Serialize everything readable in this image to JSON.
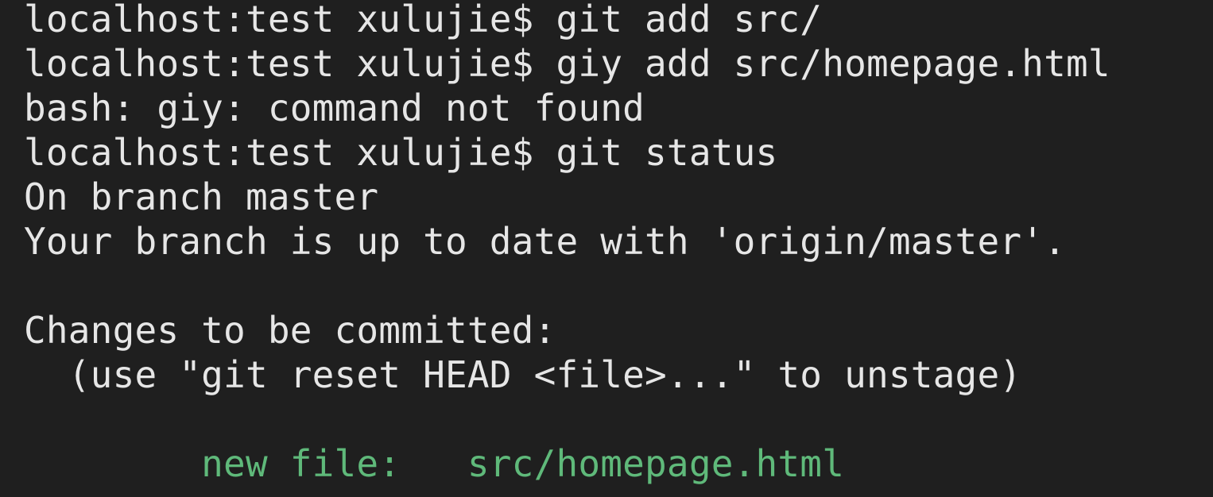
{
  "terminal": {
    "lines": [
      {
        "text": "localhost:test xulujie$ git add src/",
        "kind": "prompt"
      },
      {
        "text": "localhost:test xulujie$ giy add src/homepage.html",
        "kind": "prompt"
      },
      {
        "text": "bash: giy: command not found",
        "kind": "output"
      },
      {
        "text": "localhost:test xulujie$ git status",
        "kind": "prompt"
      },
      {
        "text": "On branch master",
        "kind": "output"
      },
      {
        "text": "Your branch is up to date with 'origin/master'.",
        "kind": "output"
      },
      {
        "text": "",
        "kind": "blank"
      },
      {
        "text": "Changes to be committed:",
        "kind": "output"
      },
      {
        "text": "  (use \"git reset HEAD <file>...\" to unstage)",
        "kind": "output"
      },
      {
        "text": "",
        "kind": "blank"
      },
      {
        "text": "        new file:   src/homepage.html",
        "kind": "staged"
      }
    ],
    "colors": {
      "background": "#1f1f1f",
      "foreground": "#e6e6e6",
      "staged": "#5fb97a"
    }
  }
}
